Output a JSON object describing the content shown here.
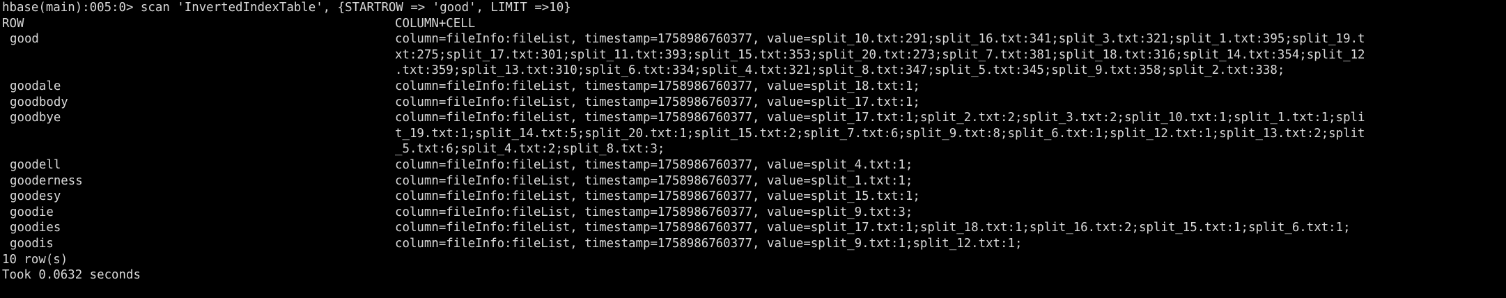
{
  "colors": {
    "background": "#000000",
    "text": "#d9d9d9"
  },
  "command": "hbase(main):005:0> scan 'InvertedIndexTable', {STARTROW => 'good', LIMIT =>10}",
  "header": {
    "row_label": "ROW",
    "cell_label": "COLUMN+CELL"
  },
  "rows": [
    {
      "key": "good",
      "cell_lines": [
        "column=fileInfo:fileList, timestamp=1758986760377, value=split_10.txt:291;split_16.txt:341;split_3.txt:321;split_1.txt:395;split_19.t",
        "xt:275;split_17.txt:301;split_11.txt:393;split_15.txt:353;split_20.txt:273;split_7.txt:381;split_18.txt:316;split_14.txt:354;split_12",
        ".txt:359;split_13.txt:310;split_6.txt:334;split_4.txt:321;split_8.txt:347;split_5.txt:345;split_9.txt:358;split_2.txt:338;"
      ]
    },
    {
      "key": "goodale",
      "cell_lines": [
        "column=fileInfo:fileList, timestamp=1758986760377, value=split_18.txt:1;"
      ]
    },
    {
      "key": "goodbody",
      "cell_lines": [
        "column=fileInfo:fileList, timestamp=1758986760377, value=split_17.txt:1;"
      ]
    },
    {
      "key": "goodbye",
      "cell_lines": [
        "column=fileInfo:fileList, timestamp=1758986760377, value=split_17.txt:1;split_2.txt:2;split_3.txt:2;split_10.txt:1;split_1.txt:1;spli",
        "t_19.txt:1;split_14.txt:5;split_20.txt:1;split_15.txt:2;split_7.txt:6;split_9.txt:8;split_6.txt:1;split_12.txt:1;split_13.txt:2;split",
        "_5.txt:6;split_4.txt:2;split_8.txt:3;"
      ]
    },
    {
      "key": "goodell",
      "cell_lines": [
        "column=fileInfo:fileList, timestamp=1758986760377, value=split_4.txt:1;"
      ]
    },
    {
      "key": "gooderness",
      "cell_lines": [
        "column=fileInfo:fileList, timestamp=1758986760377, value=split_1.txt:1;"
      ]
    },
    {
      "key": "goodesy",
      "cell_lines": [
        "column=fileInfo:fileList, timestamp=1758986760377, value=split_15.txt:1;"
      ]
    },
    {
      "key": "goodie",
      "cell_lines": [
        "column=fileInfo:fileList, timestamp=1758986760377, value=split_9.txt:3;"
      ]
    },
    {
      "key": "goodies",
      "cell_lines": [
        "column=fileInfo:fileList, timestamp=1758986760377, value=split_17.txt:1;split_18.txt:1;split_16.txt:2;split_15.txt:1;split_6.txt:1;"
      ]
    },
    {
      "key": "goodis",
      "cell_lines": [
        "column=fileInfo:fileList, timestamp=1758986760377, value=split_9.txt:1;split_12.txt:1;"
      ]
    }
  ],
  "summary": {
    "row_count": "10 row(s)",
    "took": "Took 0.0632 seconds"
  }
}
